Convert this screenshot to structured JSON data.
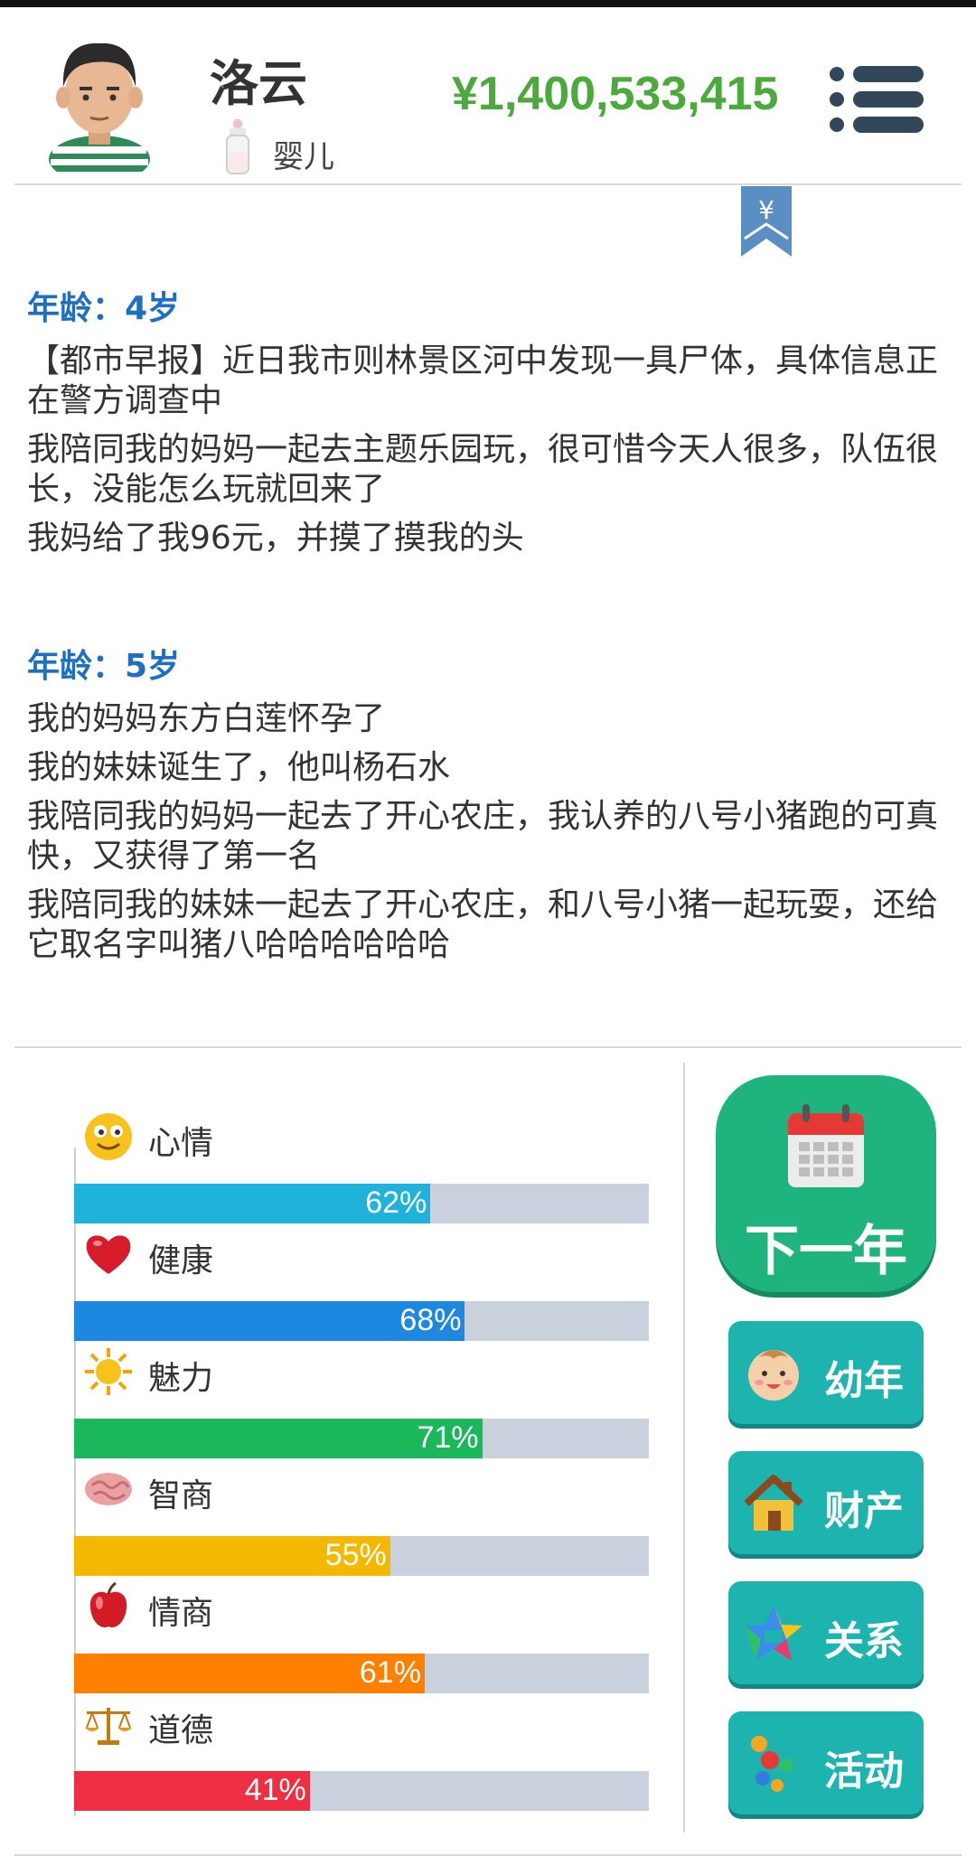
{
  "header": {
    "name": "洛云",
    "stage": "婴儿",
    "money": "¥1,400,533,415",
    "bookmark_symbol": "¥"
  },
  "log": [
    {
      "age": "年龄：4岁",
      "events": [
        "【都市早报】近日我市则林景区河中发现一具尸体，具体信息正在警方调查中",
        "我陪同我的妈妈一起去主题乐园玩，很可惜今天人很多，队伍很长，没能怎么玩就回来了",
        "我妈给了我96元，并摸了摸我的头"
      ]
    },
    {
      "age": "年龄：5岁",
      "events": [
        "我的妈妈东方白莲怀孕了",
        "我的妹妹诞生了，他叫杨石水",
        "我陪同我的妈妈一起去了开心农庄，我认养的八号小猪跑的可真快，又获得了第一名",
        "我陪同我的妹妹一起去了开心农庄，和八号小猪一起玩耍，还给它取名字叫猪八哈哈哈哈哈哈"
      ]
    }
  ],
  "stats": [
    {
      "label": "心情",
      "value": 62,
      "pct": "62%",
      "color": "#1fb3dc",
      "icon": "smiley-icon"
    },
    {
      "label": "健康",
      "value": 68,
      "pct": "68%",
      "color": "#1e88e0",
      "icon": "heart-icon"
    },
    {
      "label": "魅力",
      "value": 71,
      "pct": "71%",
      "color": "#1ab85a",
      "icon": "sun-icon"
    },
    {
      "label": "智商",
      "value": 55,
      "pct": "55%",
      "color": "#f5b800",
      "icon": "brain-icon"
    },
    {
      "label": "情商",
      "value": 61,
      "pct": "61%",
      "color": "#ff8000",
      "icon": "apple-icon"
    },
    {
      "label": "道德",
      "value": 41,
      "pct": "41%",
      "color": "#ee2f43",
      "icon": "scales-icon"
    }
  ],
  "actions": {
    "next_year": "下一年",
    "childhood": "幼年",
    "property": "财产",
    "relations": "关系",
    "activities": "活动"
  }
}
